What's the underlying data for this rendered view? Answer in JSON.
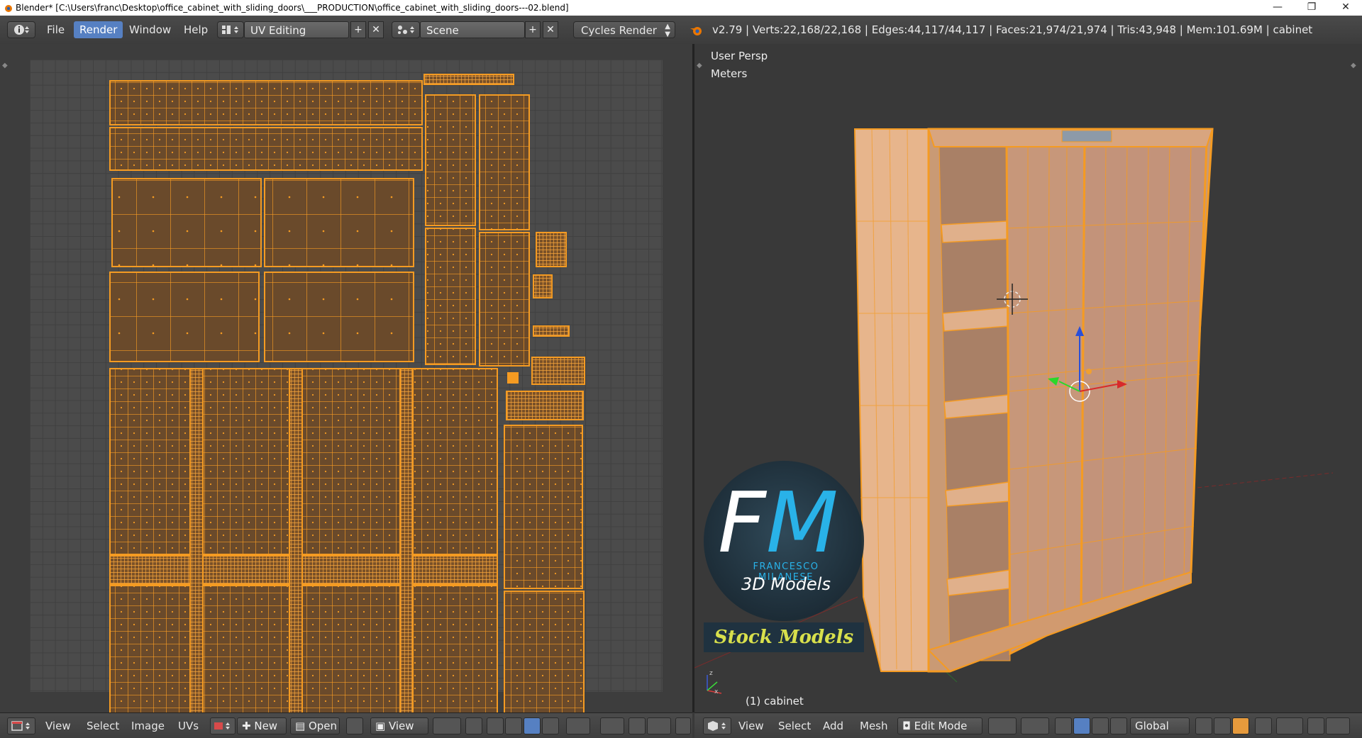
{
  "window": {
    "title": "Blender* [C:\\Users\\franc\\Desktop\\office_cabinet_with_sliding_doors\\___PRODUCTION\\office_cabinet_with_sliding_doors---02.blend]",
    "minimize": "—",
    "maximize": "❐",
    "close": "✕"
  },
  "info_header": {
    "menus": [
      "File",
      "Render",
      "Window",
      "Help"
    ],
    "active_menu": "Render",
    "screen_layout": "UV Editing",
    "scene": "Scene",
    "render_engine": "Cycles Render",
    "stats": "v2.79 | Verts:22,168/22,168 | Edges:44,117/44,117 | Faces:21,974/21,974 | Tris:43,948 | Mem:101.69M | cabinet"
  },
  "viewport": {
    "view_name": "User Persp",
    "units": "Meters",
    "object_label": "(1) cabinet"
  },
  "uv_header": {
    "menus": [
      "View",
      "Select",
      "Image",
      "UVs"
    ],
    "new_label": "New",
    "open_label": "Open",
    "view_label": "View"
  },
  "view3d_header": {
    "menus": [
      "View",
      "Select",
      "Add",
      "Mesh"
    ],
    "mode": "Edit Mode",
    "orientation": "Global"
  },
  "watermark": {
    "letter_f": "F",
    "letter_m": "M",
    "company": "FRANCESCO MILANESE",
    "subtitle": "3D Models",
    "badge": "Stock Models"
  },
  "colors": {
    "selection_orange": "#f59b22",
    "highlight_blue": "#5680c2",
    "watermark_blue": "#29b2e8",
    "badge_yellow": "#d8e04c"
  }
}
